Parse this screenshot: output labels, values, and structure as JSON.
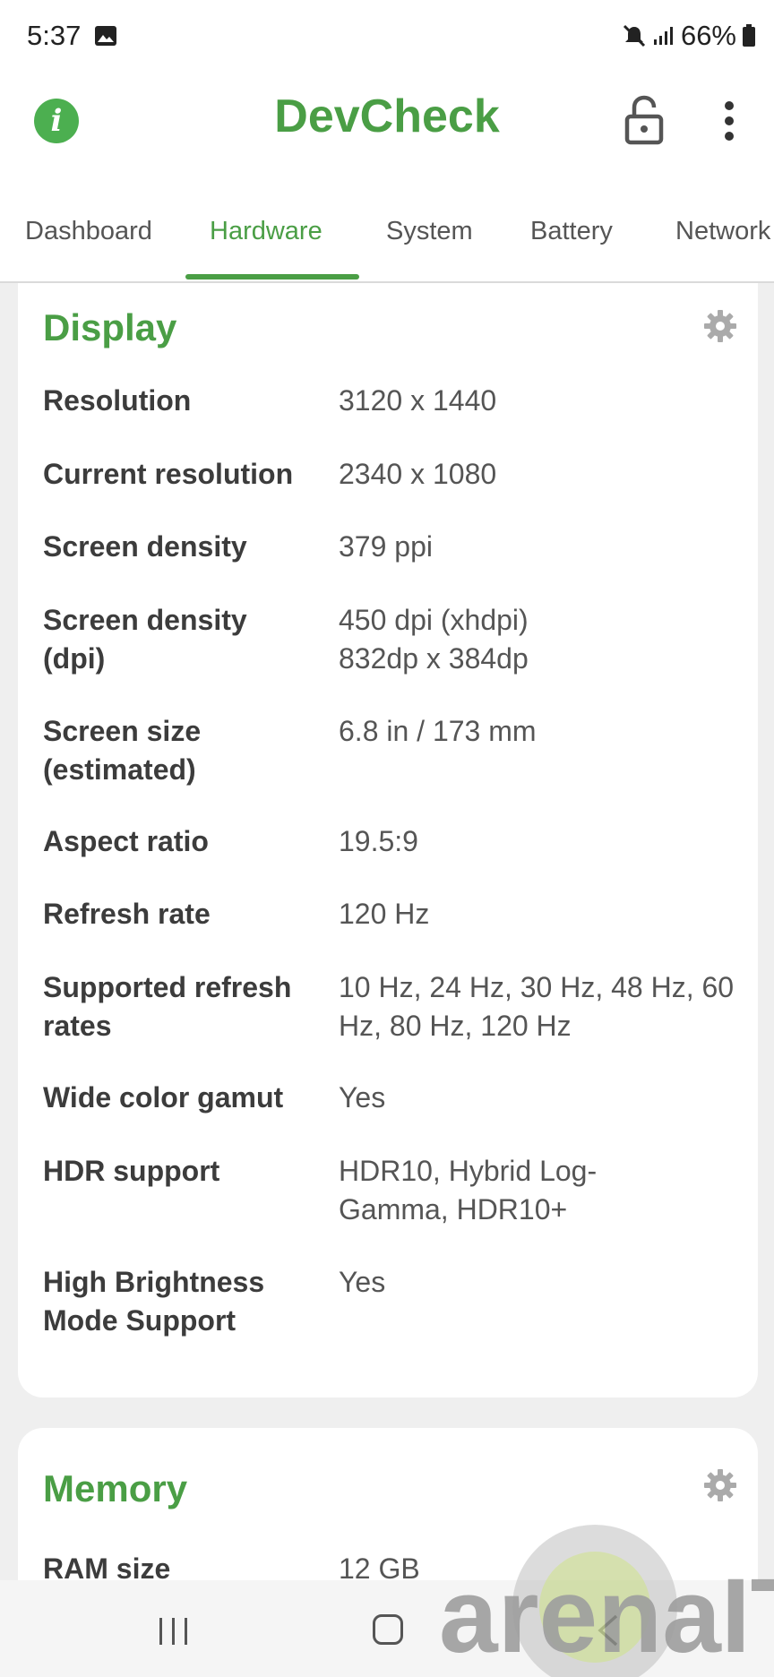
{
  "status": {
    "time": "5:37",
    "battery": "66%"
  },
  "app": {
    "title": "DevCheck"
  },
  "tabs": [
    "Dashboard",
    "Hardware",
    "System",
    "Battery",
    "Network"
  ],
  "display": {
    "title": "Display",
    "rows": [
      {
        "label": "Resolution",
        "value": "3120 x 1440"
      },
      {
        "label": "Current resolution",
        "value": "2340 x 1080"
      },
      {
        "label": "Screen density",
        "value": "379 ppi"
      },
      {
        "label": "Screen density (dpi)",
        "value": "450 dpi (xhdpi)\n832dp x 384dp"
      },
      {
        "label": "Screen size (estimated)",
        "value": "6.8 in / 173 mm"
      },
      {
        "label": "Aspect ratio",
        "value": "19.5:9"
      },
      {
        "label": "Refresh rate",
        "value": "120 Hz"
      },
      {
        "label": "Supported refresh rates",
        "value": "10 Hz, 24 Hz, 30 Hz, 48 Hz, 60 Hz, 80 Hz, 120 Hz"
      },
      {
        "label": "Wide color gamut",
        "value": "Yes"
      },
      {
        "label": "HDR support",
        "value": "HDR10, Hybrid Log-Gamma, HDR10+"
      },
      {
        "label": "High Brightness Mode Support",
        "value": "Yes"
      }
    ]
  },
  "memory": {
    "title": "Memory",
    "rows": [
      {
        "label": "RAM size",
        "value": "12 GB"
      }
    ]
  },
  "watermark": {
    "text": "arenaIT"
  },
  "colors": {
    "accent": "#4a9e45",
    "background": "#efefef",
    "card": "#ffffff"
  }
}
